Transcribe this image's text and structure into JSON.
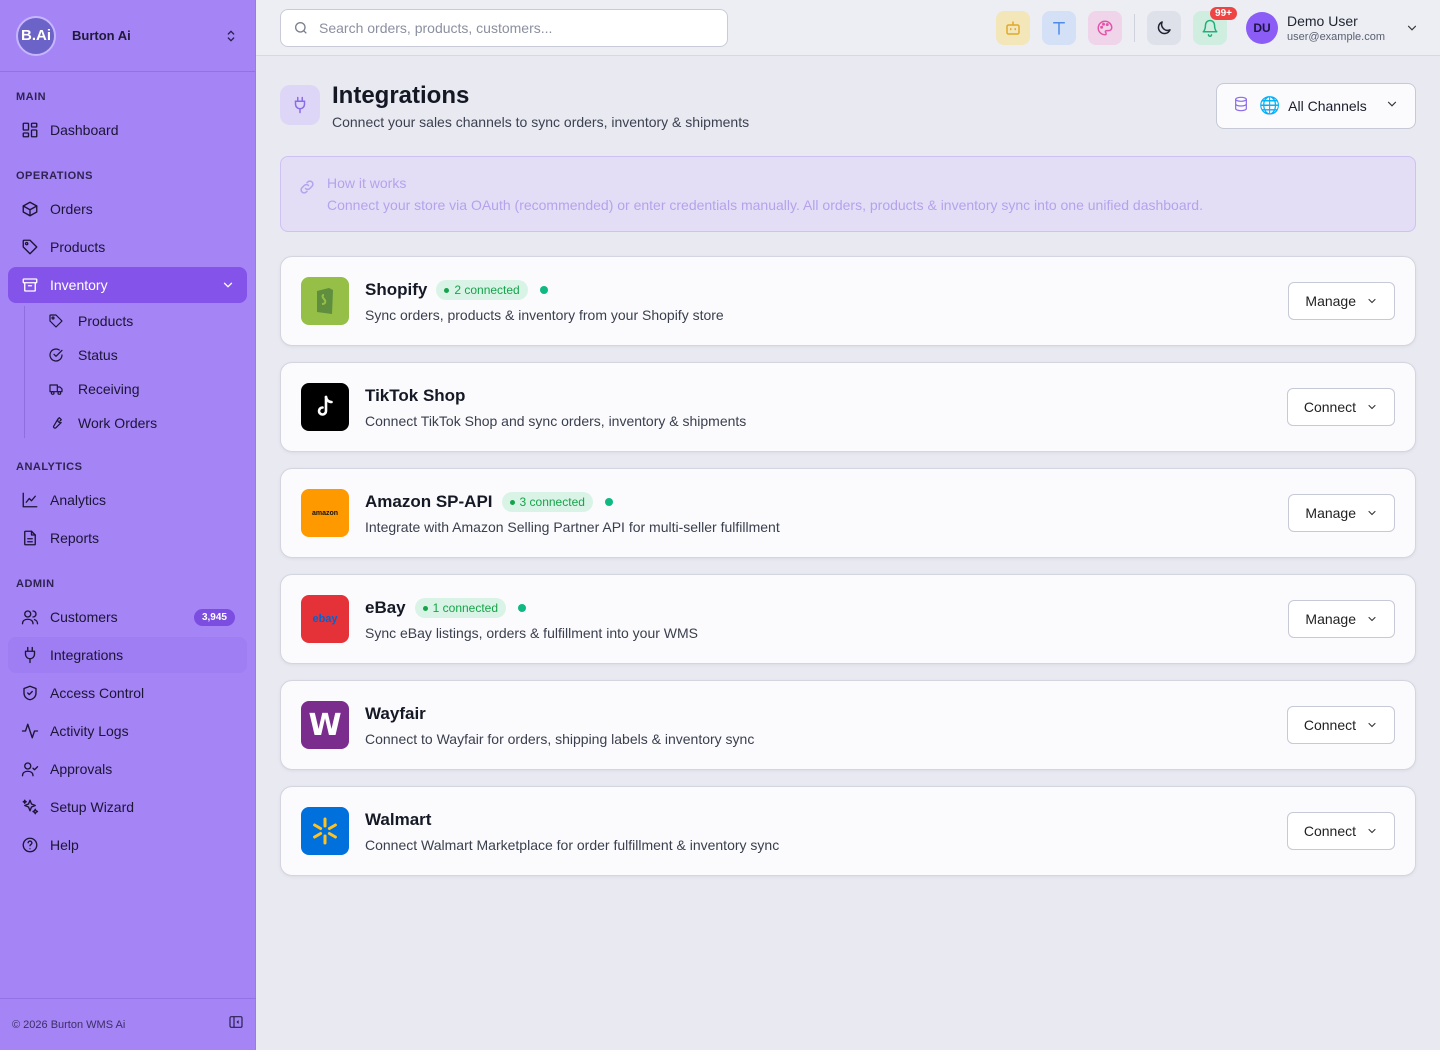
{
  "brand": {
    "logo_text": "B.Ai",
    "name": "Burton Ai"
  },
  "sidebar": {
    "sections": {
      "main": "MAIN",
      "operations": "OPERATIONS",
      "analytics": "ANALYTICS",
      "admin": "ADMIN"
    },
    "items": {
      "dashboard": "Dashboard",
      "orders": "Orders",
      "products": "Products",
      "inventory": "Inventory",
      "analytics": "Analytics",
      "reports": "Reports",
      "customers": "Customers",
      "customers_count": "3,945",
      "integrations": "Integrations",
      "access_control": "Access Control",
      "activity_logs": "Activity Logs",
      "approvals": "Approvals",
      "setup_wizard": "Setup Wizard",
      "help": "Help"
    },
    "inventory_sub": {
      "products": "Products",
      "status": "Status",
      "receiving": "Receiving",
      "work_orders": "Work Orders"
    },
    "footer": "© 2026 Burton WMS Ai"
  },
  "topbar": {
    "search_placeholder": "Search orders, products, customers...",
    "notifications_badge": "99+",
    "user_initials": "DU",
    "user_name": "Demo User",
    "user_email": "user@example.com"
  },
  "page": {
    "title": "Integrations",
    "subtitle": "Connect your sales channels to sync orders, inventory & shipments",
    "channel_filter": "All Channels",
    "info_title": "How it works",
    "info_text": "Connect your store via OAuth (recommended) or enter credentials manually. All orders, products & inventory sync into one unified dashboard."
  },
  "integrations": [
    {
      "name": "Shopify",
      "status": "2 connected",
      "description": "Sync orders, products & inventory from your Shopify store",
      "action": "Manage",
      "logo_color": "#95bf47"
    },
    {
      "name": "TikTok Shop",
      "status": "",
      "description": "Connect TikTok Shop and sync orders, inventory & shipments",
      "action": "Connect",
      "logo_color": "#000000"
    },
    {
      "name": "Amazon SP-API",
      "status": "3 connected",
      "description": "Integrate with Amazon Selling Partner API for multi-seller fulfillment",
      "action": "Manage",
      "logo_color": "#ff9900",
      "logo_text": "amazon"
    },
    {
      "name": "eBay",
      "status": "1 connected",
      "description": "Sync eBay listings, orders & fulfillment into your WMS",
      "action": "Manage",
      "logo_color": "#e53238",
      "logo_text": "ebay"
    },
    {
      "name": "Wayfair",
      "status": "",
      "description": "Connect to Wayfair for orders, shipping labels & inventory sync",
      "action": "Connect",
      "logo_color": "#7b2d8e",
      "logo_text": "W"
    },
    {
      "name": "Walmart",
      "status": "",
      "description": "Connect Walmart Marketplace for order fulfillment & inventory sync",
      "action": "Connect",
      "logo_color": "#0071dc"
    }
  ]
}
